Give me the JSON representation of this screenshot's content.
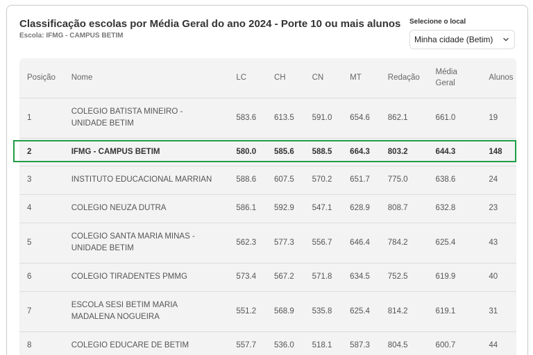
{
  "header": {
    "title": "Classificação escolas por Média Geral do ano 2024 - Porte 10 ou mais alunos",
    "subtitle": "Escola: IFMG - CAMPUS BETIM"
  },
  "selector": {
    "label": "Selecione o local",
    "value": "Minha cidade (Betim)",
    "icon": "chevron-down-icon"
  },
  "table": {
    "headers": {
      "posicao": "Posição",
      "nome": "Nome",
      "lc": "LC",
      "ch": "CH",
      "cn": "CN",
      "mt": "MT",
      "redacao": "Redação",
      "media_geral": "Média Geral",
      "alunos": "Alunos"
    },
    "rows": [
      {
        "pos": "1",
        "nome": "COLEGIO BATISTA MINEIRO - UNIDADE BETIM",
        "lc": "583.6",
        "ch": "613.5",
        "cn": "591.0",
        "mt": "654.6",
        "redacao": "862.1",
        "mg": "661.0",
        "alunos": "19"
      },
      {
        "pos": "2",
        "nome": "IFMG - CAMPUS BETIM",
        "lc": "580.0",
        "ch": "585.6",
        "cn": "588.5",
        "mt": "664.3",
        "redacao": "803.2",
        "mg": "644.3",
        "alunos": "148"
      },
      {
        "pos": "3",
        "nome": "INSTITUTO EDUCACIONAL MARRIAN",
        "lc": "588.6",
        "ch": "607.5",
        "cn": "570.2",
        "mt": "651.7",
        "redacao": "775.0",
        "mg": "638.6",
        "alunos": "24"
      },
      {
        "pos": "4",
        "nome": "COLEGIO NEUZA DUTRA",
        "lc": "586.1",
        "ch": "592.9",
        "cn": "547.1",
        "mt": "628.9",
        "redacao": "808.7",
        "mg": "632.8",
        "alunos": "23"
      },
      {
        "pos": "5",
        "nome": "COLEGIO SANTA MARIA MINAS - UNIDADE BETIM",
        "lc": "562.3",
        "ch": "577.3",
        "cn": "556.7",
        "mt": "646.4",
        "redacao": "784.2",
        "mg": "625.4",
        "alunos": "43"
      },
      {
        "pos": "6",
        "nome": "COLEGIO TIRADENTES PMMG",
        "lc": "573.4",
        "ch": "567.2",
        "cn": "571.8",
        "mt": "634.5",
        "redacao": "752.5",
        "mg": "619.9",
        "alunos": "40"
      },
      {
        "pos": "7",
        "nome": "ESCOLA SESI BETIM MARIA MADALENA NOGUEIRA",
        "lc": "551.2",
        "ch": "568.9",
        "cn": "535.8",
        "mt": "625.4",
        "redacao": "814.2",
        "mg": "619.1",
        "alunos": "31"
      },
      {
        "pos": "8",
        "nome": "COLEGIO EDUCARE DE BETIM",
        "lc": "557.7",
        "ch": "536.0",
        "cn": "518.1",
        "mt": "587.3",
        "redacao": "804.5",
        "mg": "600.7",
        "alunos": "44"
      }
    ],
    "highlight_color": "#1e9e46"
  }
}
